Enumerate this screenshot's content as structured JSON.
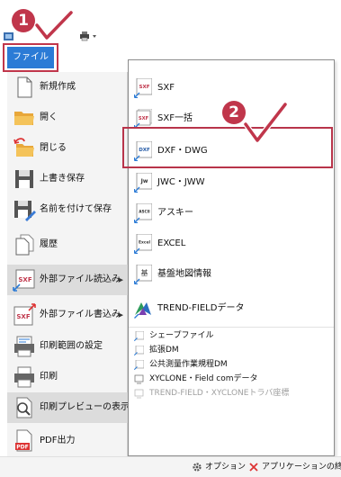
{
  "file_tab": {
    "label": "ファイル"
  },
  "left_menu": [
    {
      "label": "新規作成",
      "icon": "new-document-icon"
    },
    {
      "label": "開く",
      "icon": "open-folder-icon"
    },
    {
      "label": "閉じる",
      "icon": "close-folder-icon"
    },
    {
      "label": "上書き保存",
      "icon": "save-icon"
    },
    {
      "label": "名前を付けて保存",
      "icon": "save-as-icon"
    },
    {
      "label": "履歴",
      "icon": "history-icon"
    },
    {
      "label": "外部ファイル読込み",
      "icon": "import-sxf-icon",
      "arrow": "▶"
    },
    {
      "label": "外部ファイル書込み",
      "icon": "export-sxf-icon",
      "arrow": "▶"
    },
    {
      "label": "印刷範囲の設定",
      "icon": "print-range-icon"
    },
    {
      "label": "印刷",
      "icon": "printer-icon"
    },
    {
      "label": "印刷プレビューの表示",
      "icon": "print-preview-icon"
    },
    {
      "label": "PDF出力",
      "icon": "pdf-icon"
    }
  ],
  "right_panel": {
    "big_items": [
      {
        "label": "SXF",
        "icon_text": "SXF"
      },
      {
        "label": "SXF一括",
        "icon_text": "SXF"
      },
      {
        "label": "DXF・DWG",
        "icon_text": "DXF"
      },
      {
        "label": "JWC・JWW",
        "icon_text": "Jw"
      },
      {
        "label": "アスキー",
        "icon_text": "ASCII"
      },
      {
        "label": "EXCEL",
        "icon_text": "Excel"
      },
      {
        "label": "基盤地図情報",
        "icon_text": "基"
      },
      {
        "label": "TREND-FIELDデータ",
        "icon_text": ""
      }
    ],
    "small_items": [
      {
        "label": "シェープファイル",
        "disabled": false
      },
      {
        "label": "拡張DM",
        "disabled": false
      },
      {
        "label": "公共測量作業規程DM",
        "disabled": false
      },
      {
        "label": "XYCLONE・Field comデータ",
        "disabled": false
      },
      {
        "label": "TREND-FIELD・XYCLONEトラバ座標",
        "disabled": true
      }
    ]
  },
  "badges": {
    "step1": "1",
    "step2": "2"
  },
  "footer": {
    "options": "オプション",
    "exit": "アプリケーションの終了"
  },
  "colors": {
    "accent": "#2b7bd6",
    "highlight": "#c0364b",
    "active_item": "#dcdcdc"
  }
}
